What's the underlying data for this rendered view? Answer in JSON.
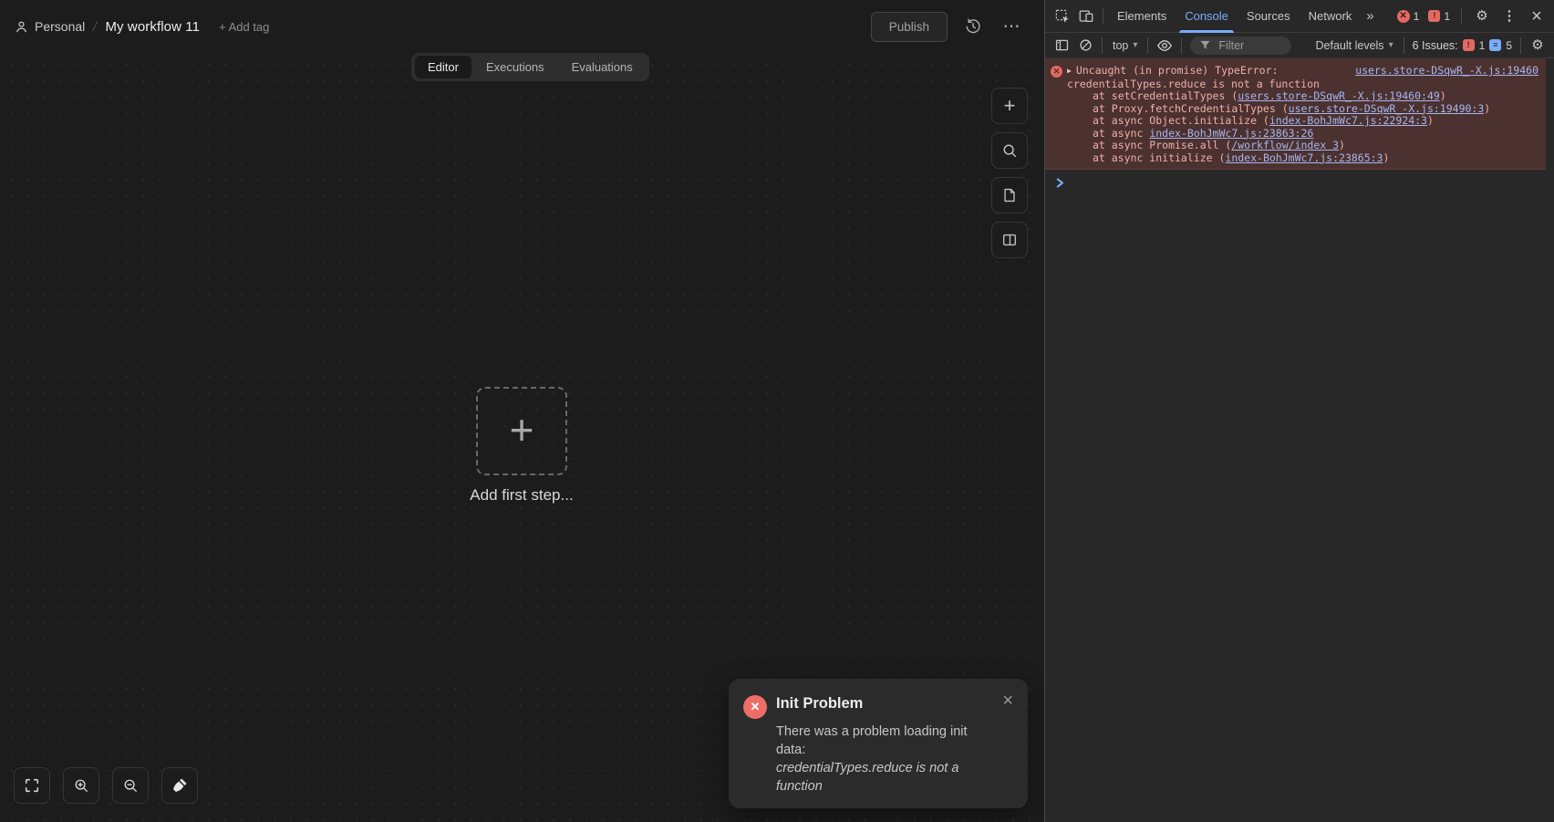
{
  "colors": {
    "accent_blue": "#7cacf8",
    "error_red": "#e46962",
    "console_error_bg": "#4b312f",
    "console_error_text": "#efb0aa",
    "console_link": "#a8b7f1",
    "toast_icon_red": "#ed6e66"
  },
  "editor": {
    "breadcrumb": {
      "owner": "Personal",
      "separator": "/",
      "workflow_title": "My workflow 11",
      "add_tag_label": "+ Add tag"
    },
    "header": {
      "publish_label": "Publish"
    },
    "tabs": [
      {
        "label": "Editor"
      },
      {
        "label": "Executions"
      },
      {
        "label": "Evaluations"
      }
    ],
    "canvas": {
      "plus_glyph": "+",
      "add_first_step_label": "Add first step..."
    }
  },
  "toast": {
    "title": "Init Problem",
    "message": "There was a problem loading init data:",
    "detail": "credentialTypes.reduce is not a function",
    "close_glyph": "×",
    "icon_glyph": "✕"
  },
  "devtools": {
    "tabs": {
      "elements": "Elements",
      "console": "Console",
      "sources": "Sources",
      "network": "Network"
    },
    "top_badges": {
      "error_count": "1",
      "issue_count": "1"
    },
    "toolbar": {
      "context_label": "top",
      "filter_placeholder": "Filter",
      "levels_label": "Default levels",
      "issues_label": "6 Issues:",
      "issues_error_count": "1",
      "issues_info_count": "5"
    },
    "console": {
      "error": {
        "header": "Uncaught (in promise) TypeError:",
        "header_wrap": "credentialTypes.reduce is not a function",
        "source_link": "users.store-DSqwR_-X.js:19460",
        "stack": [
          {
            "prefix": "at setCredentialTypes (",
            "link": "users.store-DSqwR_-X.js:19460:49",
            "suffix": ")"
          },
          {
            "prefix": "at Proxy.fetchCredentialTypes (",
            "link": "users.store-DSqwR_-X.js:19490:3",
            "suffix": ")"
          },
          {
            "prefix": "at async Object.initialize (",
            "link": "index-BohJmWc7.js:22924:3",
            "suffix": ")"
          },
          {
            "prefix": "at async ",
            "link": "index-BohJmWc7.js:23863:26",
            "suffix": ""
          },
          {
            "prefix": "at async Promise.all (",
            "link": "/workflow/index 3",
            "suffix": ")"
          },
          {
            "prefix": "at async initialize (",
            "link": "index-BohJmWc7.js:23865:3",
            "suffix": ")"
          }
        ]
      }
    }
  },
  "icons": {
    "more_horizontal": "⋯",
    "more_vertical": "⋮",
    "close": "×",
    "gear": "⚙",
    "overflow_tabs": "»",
    "dropdown_arrow": "▾",
    "error_x": "✕",
    "issue_mark": "!",
    "info_mark": "≡"
  }
}
